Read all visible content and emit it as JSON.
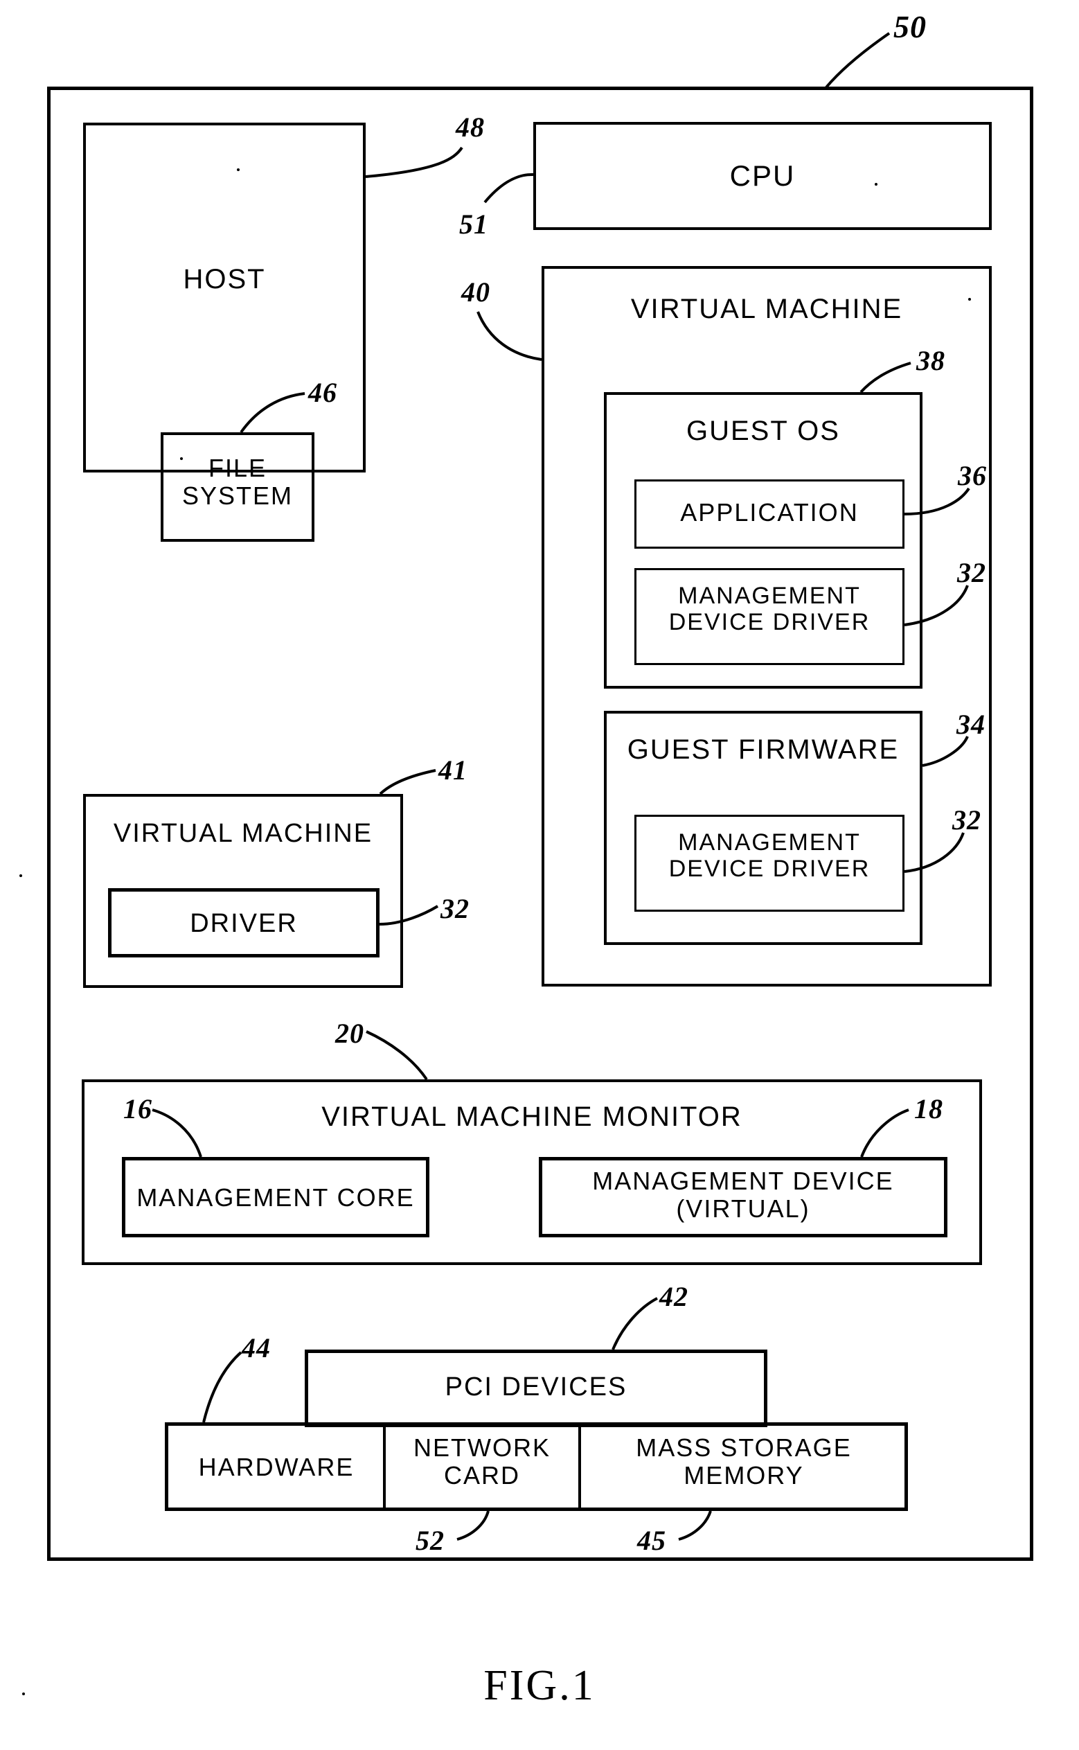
{
  "figure": {
    "caption": "FIG.1",
    "type": "patent-block-diagram"
  },
  "system": {
    "ref": "50",
    "boxes": {
      "host": {
        "label": "HOST",
        "ref": "48"
      },
      "file_system": {
        "label": "FILE\nSYSTEM",
        "ref": "46"
      },
      "cpu": {
        "label": "CPU",
        "ref": "51"
      },
      "virtual_machine": {
        "label": "VIRTUAL  MACHINE",
        "ref": "40"
      },
      "guest_os": {
        "label": "GUEST  OS",
        "ref": "38"
      },
      "application": {
        "label": "APPLICATION",
        "ref": "36"
      },
      "guest_os_mdd": {
        "label": "MANAGEMENT\nDEVICE  DRIVER",
        "ref": "32"
      },
      "guest_firmware": {
        "label": "GUEST  FIRMWARE",
        "ref": "34"
      },
      "guest_fw_mdd": {
        "label": "MANAGEMENT\nDEVICE  DRIVER",
        "ref": "32"
      },
      "vm_left": {
        "label": "VIRTUAL  MACHINE",
        "ref": "41"
      },
      "vm_left_driver": {
        "label": "DRIVER",
        "ref": "32"
      },
      "vmm": {
        "label": "VIRTUAL  MACHINE  MONITOR",
        "ref": "20"
      },
      "management_core": {
        "label": "MANAGEMENT  CORE",
        "ref": "16"
      },
      "management_device": {
        "label": "MANAGEMENT  DEVICE\n(VIRTUAL)",
        "ref": "18"
      },
      "pci_devices": {
        "label": "PCI  DEVICES",
        "ref": "42"
      },
      "hardware": {
        "label": "HARDWARE",
        "ref": "44"
      },
      "network_card": {
        "label": "NETWORK\nCARD",
        "ref": "52"
      },
      "mass_storage_memory": {
        "label": "MASS  STORAGE\nMEMORY",
        "ref": "45"
      }
    }
  },
  "colors": {
    "ink": "#000000",
    "paper": "#ffffff"
  }
}
